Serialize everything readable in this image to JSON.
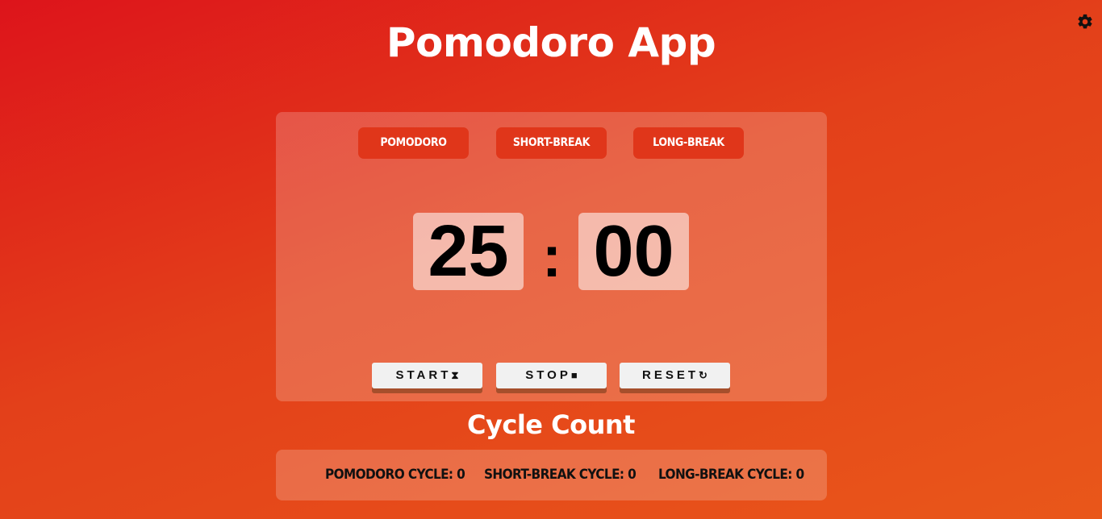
{
  "app": {
    "title": "Pomodoro App",
    "settings_icon": "gear-icon"
  },
  "modes": [
    {
      "label": "POMODORO"
    },
    {
      "label": "SHORT-BREAK"
    },
    {
      "label": "LONG-BREAK"
    }
  ],
  "timer": {
    "minutes": "25",
    "separator": ":",
    "seconds": "00"
  },
  "controls": {
    "start_label": "START",
    "start_icon": "⧗",
    "stop_label": "STOP",
    "stop_icon": "■",
    "reset_label": "RESET",
    "reset_icon": "↻"
  },
  "cycles": {
    "title": "Cycle Count",
    "pomodoro": "POMODORO CYCLE: 0",
    "short_break": "SHORT-BREAK CYCLE: 0",
    "long_break": "LONG-BREAK CYCLE: 0"
  },
  "colors": {
    "accent": "#e0361a",
    "background_start": "#dd141b",
    "background_end": "#e9571a"
  }
}
